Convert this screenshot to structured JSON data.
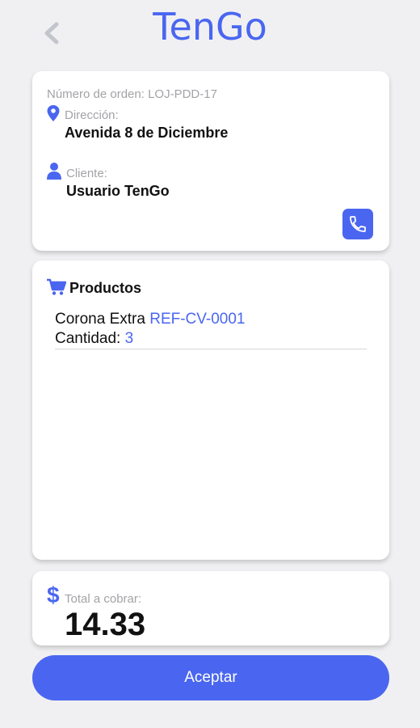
{
  "header": {
    "title": "TenGo",
    "back_icon": "chevron-left-icon"
  },
  "order": {
    "number_text": "Número de orden: LOJ-PDD-17",
    "address_label": "Dirección:",
    "address_value": "Avenida 8 de Diciembre",
    "client_label": "Cliente:",
    "client_value": "Usuario TenGo",
    "icons": [
      "map-pin-icon",
      "user-icon",
      "phone-icon"
    ]
  },
  "products": {
    "title": "Productos",
    "icon": "cart-icon",
    "items": [
      {
        "name": "Corona Extra",
        "ref": "REF-CV-0001",
        "qty_label": "Cantidad:",
        "qty": "3"
      }
    ]
  },
  "total": {
    "icon": "dollar-icon",
    "symbol": "$",
    "label": "Total a cobrar:",
    "value": "14.33"
  },
  "actions": {
    "accept_label": "Aceptar"
  },
  "colors": {
    "accent": "#4a66f0",
    "background": "#f0f0f2",
    "card": "#ffffff",
    "muted_text": "#a3a3a8"
  }
}
